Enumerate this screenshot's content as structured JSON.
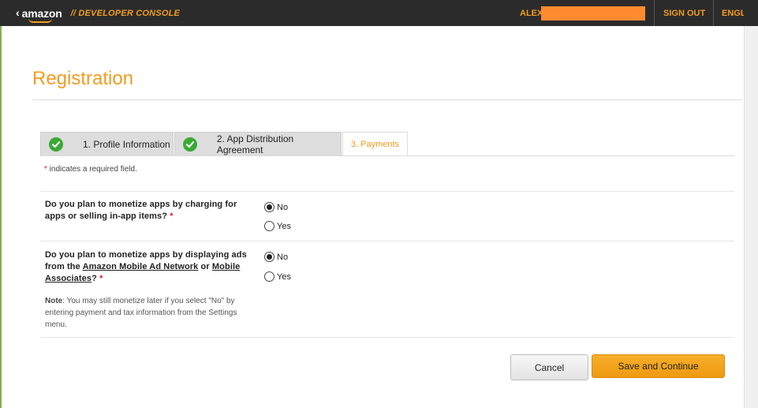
{
  "header": {
    "logo_text": "amazon",
    "console_title": "// DEVELOPER CONSOLE",
    "user_name": "ALEX",
    "sign_out": "SIGN OUT",
    "language": "ENGLISH"
  },
  "page": {
    "title": "Registration"
  },
  "tabs": [
    {
      "label": "1. Profile Information",
      "completed": true
    },
    {
      "label": "2. App Distribution Agreement",
      "completed": true
    },
    {
      "label": "3. Payments",
      "completed": false,
      "active": true
    }
  ],
  "required_note": {
    "star": "*",
    "text": " indicates a required field."
  },
  "questions": [
    {
      "text": "Do you plan to monetize apps by charging for apps or selling in-app items?",
      "star": "*",
      "options": [
        {
          "label": "No",
          "checked": true
        },
        {
          "label": "Yes",
          "checked": false
        }
      ]
    },
    {
      "text_before": "Do you plan to monetize apps by displaying ads from the ",
      "link1": "Amazon Mobile Ad Network",
      "text_mid": " or ",
      "link2": "Mobile Associates",
      "text_after": "?",
      "star": "*",
      "note_label": "Note",
      "note_text": ": You may still monetize later if you select \"No\" by entering payment and tax information from the Settings menu.",
      "options": [
        {
          "label": "No",
          "checked": true
        },
        {
          "label": "Yes",
          "checked": false
        }
      ]
    }
  ],
  "buttons": {
    "cancel": "Cancel",
    "save": "Save and Continue"
  },
  "colors": {
    "accent": "#f39c20",
    "topbar": "#2b2b2b",
    "check": "#3aaa35",
    "required": "#d0202a"
  }
}
